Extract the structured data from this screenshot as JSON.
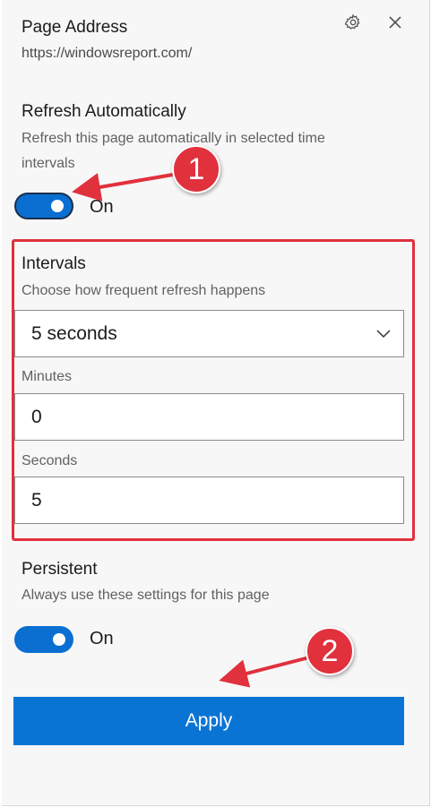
{
  "header": {
    "title": "Page Address",
    "url": "https://windowsreport.com/"
  },
  "refresh": {
    "title": "Refresh Automatically",
    "description": "Refresh this page automatically in selected time intervals",
    "toggle_state": "On"
  },
  "intervals": {
    "title": "Intervals",
    "description": "Choose how frequent refresh happens",
    "selected": "5 seconds",
    "minutes_label": "Minutes",
    "minutes_value": "0",
    "seconds_label": "Seconds",
    "seconds_value": "5"
  },
  "persistent": {
    "title": "Persistent",
    "description": "Always use these settings for this page",
    "toggle_state": "On"
  },
  "apply_label": "Apply",
  "annotations": {
    "badge_1": "1",
    "badge_2": "2"
  },
  "icons": {
    "settings": "gear-icon",
    "close": "close-icon",
    "dropdown": "chevron-down-icon"
  },
  "colors": {
    "accent": "#0a74d4",
    "annotation": "#e0313d"
  }
}
